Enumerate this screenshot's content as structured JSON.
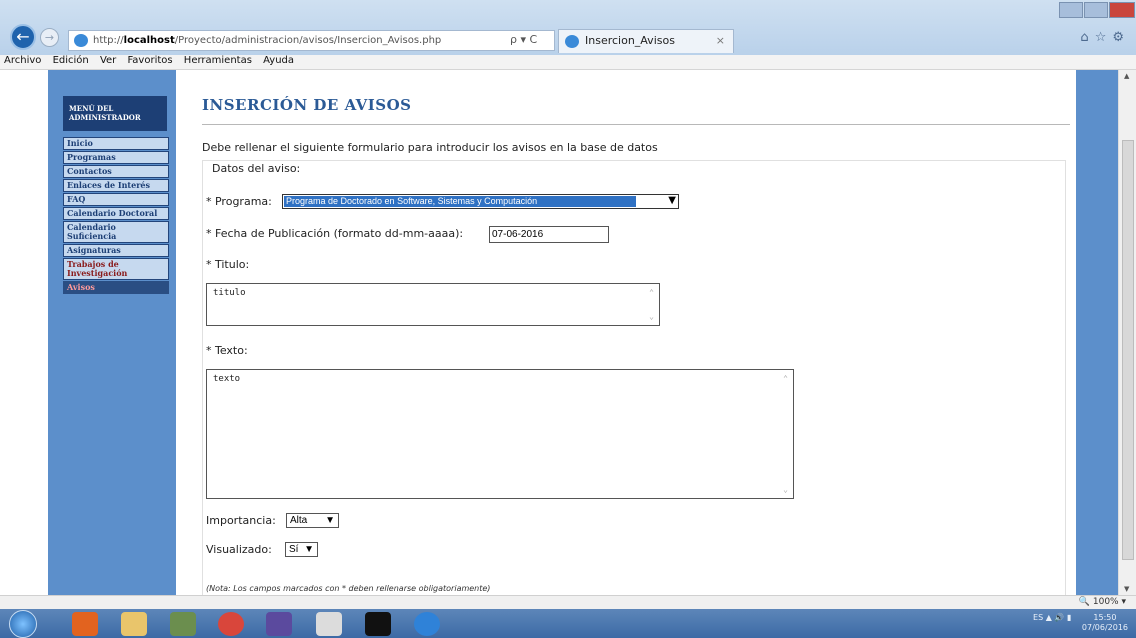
{
  "browser": {
    "url_prefix": "http://",
    "url_host": "localhost",
    "url_path": "/Proyecto/administracion/avisos/Insercion_Avisos.php",
    "search_controls": "ρ ▾ C",
    "tab_title": "Insercion_Avisos",
    "tab_close": "×"
  },
  "menubar": [
    "Archivo",
    "Edición",
    "Ver",
    "Favoritos",
    "Herramientas",
    "Ayuda"
  ],
  "sidebar": {
    "header_line1": "MENÚ DEL",
    "header_line2": "ADMINISTRADOR",
    "items": [
      {
        "label": "Inicio"
      },
      {
        "label": "Programas"
      },
      {
        "label": "Contactos"
      },
      {
        "label": "Enlaces de Interés"
      },
      {
        "label": "FAQ"
      },
      {
        "label": "Calendario Doctoral"
      },
      {
        "label": "Calendario Suficiencia"
      },
      {
        "label": "Asignaturas"
      },
      {
        "label": "Trabajos de Investigación"
      },
      {
        "label": "Avisos"
      }
    ]
  },
  "page": {
    "title": "INSERCIÓN DE AVISOS",
    "intro": "Debe rellenar el siguiente formulario para introducir los avisos en la base de datos",
    "legend": "Datos del aviso:",
    "programa_label": "* Programa:",
    "programa_value": "Programa de Doctorado en Software, Sistemas y Computación",
    "fecha_label": "* Fecha de Publicación (formato dd-mm-aaaa):",
    "fecha_value": "07-06-2016",
    "titulo_label": "* Titulo:",
    "titulo_value": "titulo",
    "texto_label": "* Texto:",
    "texto_value": "texto",
    "importancia_label": "Importancia:",
    "importancia_value": "Alta",
    "visualizado_label": "Visualizado:",
    "visualizado_value": "Sí",
    "nota": "(Nota: Los campos marcados con * deben rellenarse obligatoriamente)"
  },
  "status": {
    "zoom": "100%"
  },
  "tray": {
    "lang": "ES",
    "time": "15:50",
    "date": "07/06/2016"
  },
  "colors": {
    "sidebar_blue": "#5c8fcb",
    "header_navy": "#1d3f75",
    "title_blue": "#2b5a96",
    "select_highlight": "#2f71c3"
  }
}
